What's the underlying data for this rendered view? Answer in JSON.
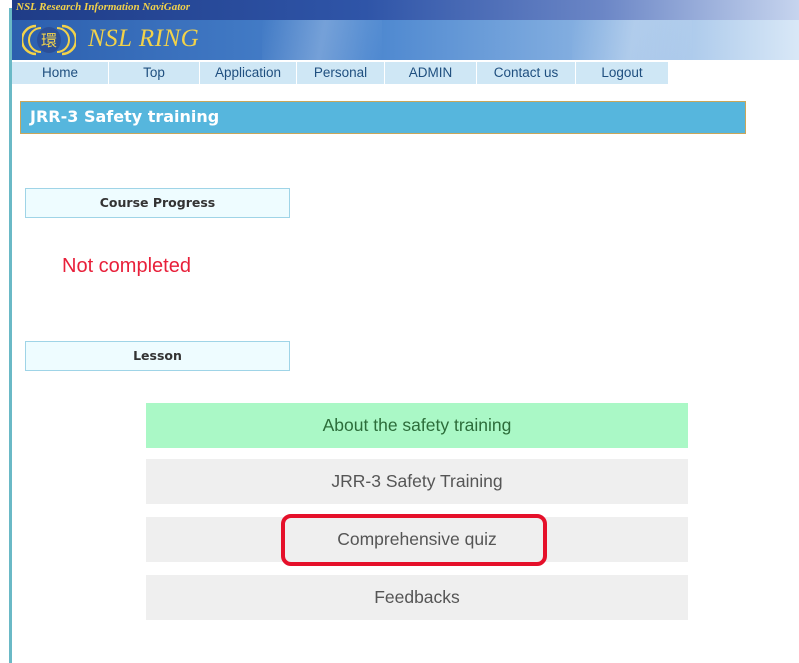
{
  "header": {
    "banner_text": "NSL Research Information NaviGator",
    "logo_text": "NSL RING",
    "logo_glyph": "環",
    "logo_icon": "ring-logo-icon"
  },
  "nav": {
    "tabs": [
      {
        "label": "Home"
      },
      {
        "label": "Top"
      },
      {
        "label": "Application"
      },
      {
        "label": "Personal"
      },
      {
        "label": "ADMIN"
      },
      {
        "label": "Contact us"
      },
      {
        "label": "Logout"
      }
    ]
  },
  "page": {
    "title": "JRR-3 Safety training"
  },
  "progress": {
    "heading": "Course Progress",
    "status": "Not completed"
  },
  "lesson": {
    "heading": "Lesson",
    "items": [
      {
        "label": "About the safety training"
      },
      {
        "label": "JRR-3 Safety Training"
      },
      {
        "label": "Comprehensive quiz"
      },
      {
        "label": "Feedbacks"
      }
    ]
  },
  "colors": {
    "title_bar": "#56b6dd",
    "status_red": "#e8203a",
    "active_lesson_bg": "#aaf8c6",
    "highlight_outline": "#e5102a"
  }
}
